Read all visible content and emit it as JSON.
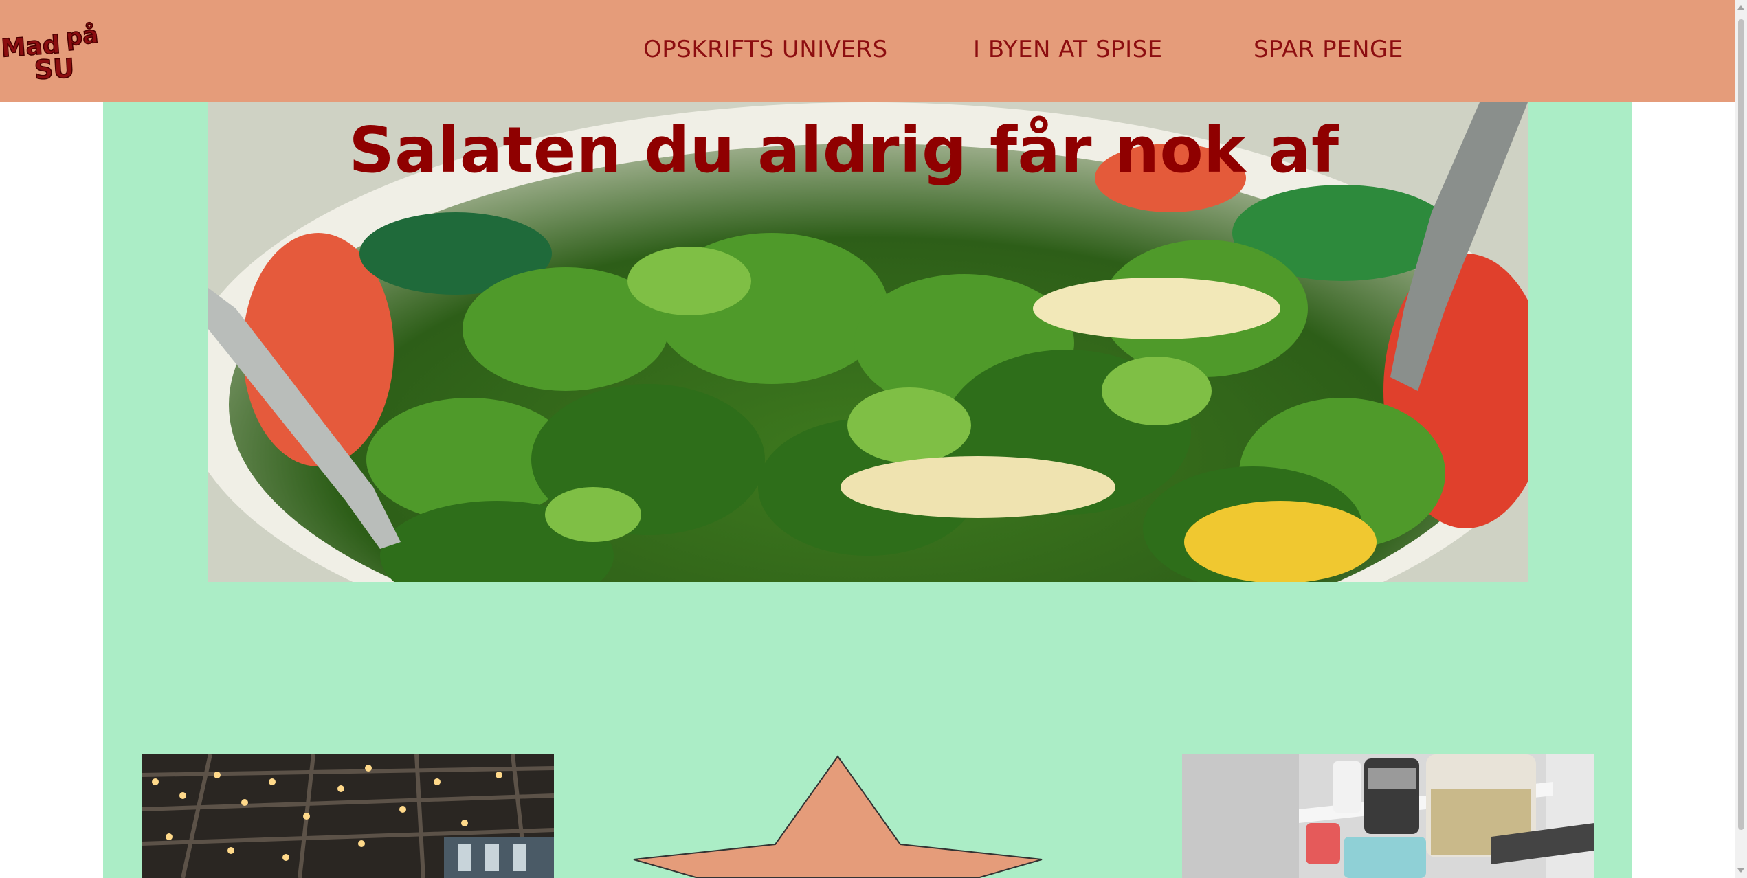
{
  "logo": {
    "text": "Mad på SU"
  },
  "nav": {
    "links": [
      {
        "label": "OPSKRIFTS UNIVERS"
      },
      {
        "label": "I BYEN AT SPISE"
      },
      {
        "label": "SPAR PENGE"
      }
    ]
  },
  "hero": {
    "title": "Salaten du aldrig får nok af",
    "image": "salad-bowl-photo"
  },
  "thumbnails": [
    {
      "image": "restaurant-interior-photo"
    },
    {
      "image": "star-shape"
    },
    {
      "image": "pantry-shelf-photo"
    }
  ],
  "colors": {
    "nav_bg": "#e59c7a",
    "main_bg": "#abedc6",
    "accent_text": "#8c0d10",
    "star_fill": "#e59c7a"
  }
}
